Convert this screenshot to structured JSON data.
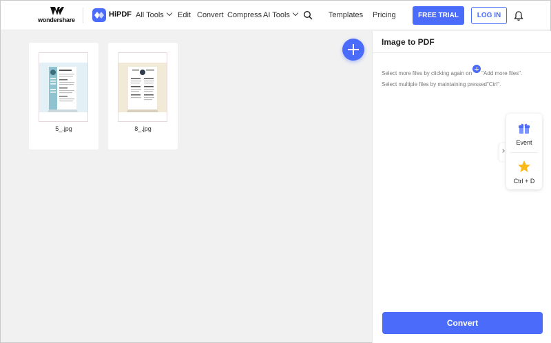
{
  "header": {
    "brand": "wondershare",
    "product": "HiPDF",
    "nav": [
      {
        "label": "All Tools",
        "dropdown": true
      },
      {
        "label": "Edit",
        "dropdown": false
      },
      {
        "label": "Convert",
        "dropdown": false
      },
      {
        "label": "Compress",
        "dropdown": false
      },
      {
        "label": "AI Tools",
        "dropdown": true
      },
      {
        "label": "Templates",
        "dropdown": false
      },
      {
        "label": "Pricing",
        "dropdown": false
      }
    ],
    "free_trial_label": "FREE TRIAL",
    "login_label": "LOG IN"
  },
  "files": [
    {
      "name": "5_.jpg"
    },
    {
      "name": "8_.jpg"
    }
  ],
  "panel": {
    "title": "Image to PDF",
    "hint1_before": "Select more files by clicking again on",
    "hint1_after": "\"Add more files\".",
    "hint2": "Select multiple files by maintaining pressed\"Ctrl\".",
    "convert_label": "Convert"
  },
  "widget": {
    "event_label": "Event",
    "bookmark_label": "Ctrl + D"
  },
  "colors": {
    "accent": "#4b6bfb",
    "background": "#f1f1f1"
  }
}
